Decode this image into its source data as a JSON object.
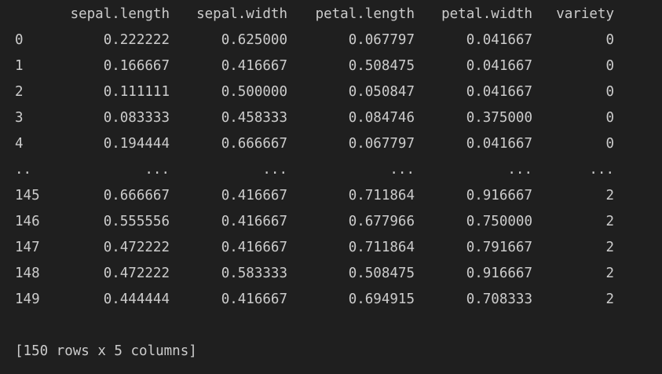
{
  "dataframe": {
    "columns": [
      "sepal.length",
      "sepal.width",
      "petal.length",
      "petal.width",
      "variety"
    ],
    "rows": [
      {
        "index": "0",
        "cells": [
          "0.222222",
          "0.625000",
          "0.067797",
          "0.041667",
          "0"
        ]
      },
      {
        "index": "1",
        "cells": [
          "0.166667",
          "0.416667",
          "0.508475",
          "0.041667",
          "0"
        ]
      },
      {
        "index": "2",
        "cells": [
          "0.111111",
          "0.500000",
          "0.050847",
          "0.041667",
          "0"
        ]
      },
      {
        "index": "3",
        "cells": [
          "0.083333",
          "0.458333",
          "0.084746",
          "0.375000",
          "0"
        ]
      },
      {
        "index": "4",
        "cells": [
          "0.194444",
          "0.666667",
          "0.067797",
          "0.041667",
          "0"
        ]
      },
      {
        "index": "..",
        "cells": [
          "...",
          "...",
          "...",
          "...",
          "..."
        ]
      },
      {
        "index": "145",
        "cells": [
          "0.666667",
          "0.416667",
          "0.711864",
          "0.916667",
          "2"
        ]
      },
      {
        "index": "146",
        "cells": [
          "0.555556",
          "0.416667",
          "0.677966",
          "0.750000",
          "2"
        ]
      },
      {
        "index": "147",
        "cells": [
          "0.472222",
          "0.416667",
          "0.711864",
          "0.791667",
          "2"
        ]
      },
      {
        "index": "148",
        "cells": [
          "0.472222",
          "0.583333",
          "0.508475",
          "0.916667",
          "2"
        ]
      },
      {
        "index": "149",
        "cells": [
          "0.444444",
          "0.416667",
          "0.694915",
          "0.708333",
          "2"
        ]
      }
    ],
    "summary": "[150 rows x 5 columns]"
  },
  "colors": {
    "background": "#1f1f1f",
    "text": "#cccccc"
  }
}
